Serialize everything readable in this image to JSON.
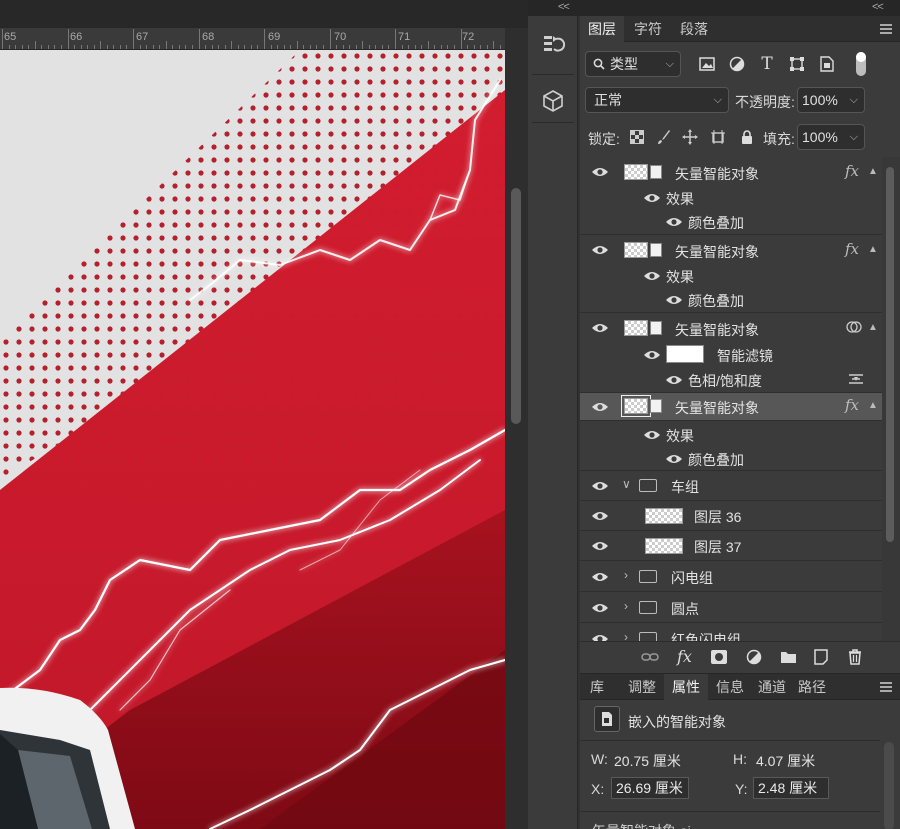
{
  "ruler": {
    "numbers": [
      "65",
      "66",
      "67",
      "68",
      "69",
      "70",
      "71",
      "72"
    ]
  },
  "toolstrip": {
    "items": [
      "history-icon",
      "3d-cube-icon"
    ],
    "collapse": "<<"
  },
  "panel_top": {
    "collapse": "<<"
  },
  "layers_panel": {
    "tabs": [
      "图层",
      "字符",
      "段落"
    ],
    "active_tab": "图层",
    "filter": {
      "label": "类型",
      "icon": "search-icon"
    },
    "filter_icons": [
      "image-filter-icon",
      "adjustment-filter-icon",
      "type-filter-icon",
      "shape-filter-icon",
      "smart-object-filter-icon",
      "filter-toggle-icon"
    ],
    "blend_mode": "正常",
    "opacity_label": "不透明度:",
    "opacity_value": "100%",
    "lock_label": "锁定:",
    "fill_label": "填充:",
    "fill_value": "100%",
    "layers": [
      {
        "name": "矢量智能对象",
        "badge": "fx"
      },
      {
        "name": "效果"
      },
      {
        "name": "颜色叠加"
      },
      {
        "name": "矢量智能对象",
        "badge": "fx"
      },
      {
        "name": "效果"
      },
      {
        "name": "颜色叠加"
      },
      {
        "name": "矢量智能对象",
        "badge": "smart-filter-icon"
      },
      {
        "name": "智能滤镜"
      },
      {
        "name": "色相/饱和度"
      },
      {
        "name": "矢量智能对象",
        "badge": "fx",
        "selected": true
      },
      {
        "name": "效果"
      },
      {
        "name": "颜色叠加"
      },
      {
        "name": "车组",
        "type": "group",
        "expanded": true
      },
      {
        "name": "图层 36"
      },
      {
        "name": "图层 37"
      },
      {
        "name": "闪电组",
        "type": "group"
      },
      {
        "name": "圆点",
        "type": "group"
      },
      {
        "name": "红色闪电组",
        "type": "group"
      }
    ],
    "footer_icons": [
      "link-icon",
      "fx-icon",
      "mask-icon",
      "adjustment-icon",
      "new-group-icon",
      "new-layer-icon",
      "trash-icon"
    ]
  },
  "properties_panel": {
    "tabs": [
      "库",
      "调整",
      "属性",
      "信息",
      "通道",
      "路径"
    ],
    "active_tab": "属性",
    "type_label": "嵌入的智能对象",
    "w_label": "W:",
    "w_value": "20.75 厘米",
    "h_label": "H:",
    "h_value": "4.07 厘米",
    "x_label": "X:",
    "x_value": "26.69 厘米",
    "y_label": "Y:",
    "y_value": "2.48 厘米",
    "filename": "矢量智能对象.ai"
  },
  "colors": {
    "accent_red": "#cd1b2c",
    "panel_bg": "#3b3b3b",
    "selected_row": "#575757"
  }
}
